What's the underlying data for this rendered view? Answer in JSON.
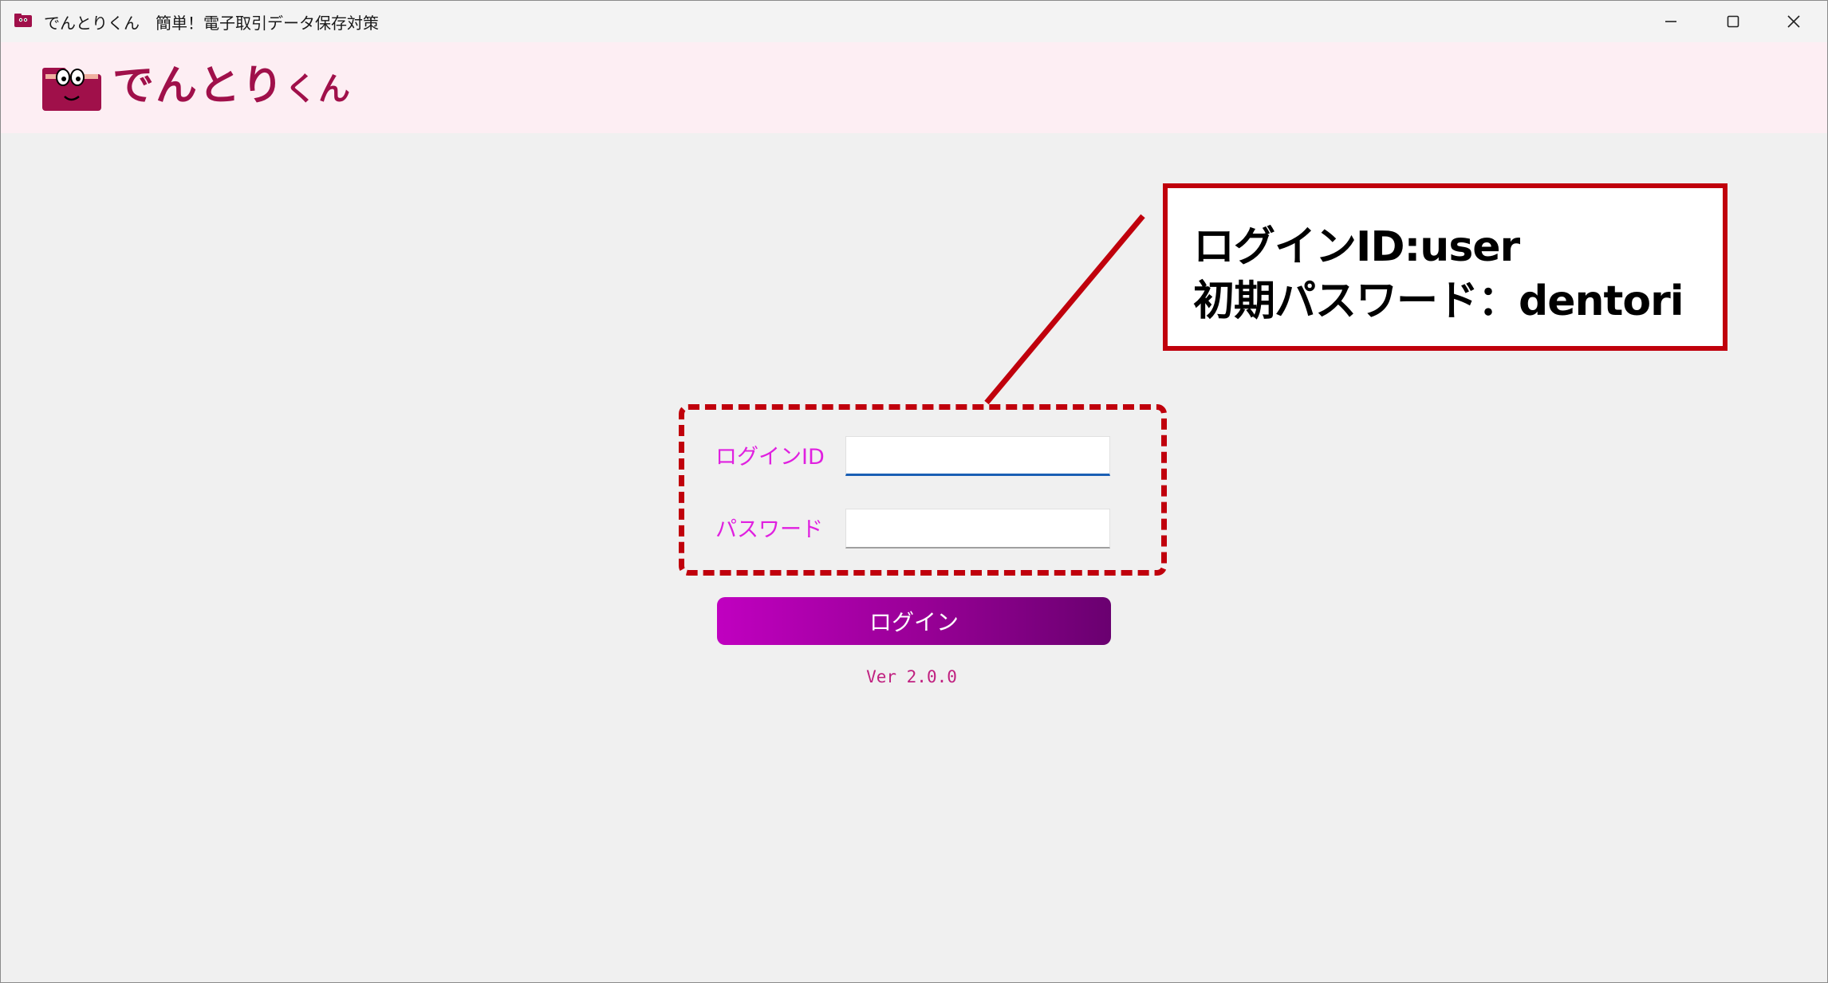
{
  "window": {
    "title": "でんとりくん　簡単！電子取引データ保存対策",
    "app_icon": "folder-mascot-icon"
  },
  "controls": {
    "minimize_icon": "minimize-icon",
    "maximize_icon": "maximize-icon",
    "close_icon": "close-icon"
  },
  "header": {
    "logo_text_main": "でんとり",
    "logo_text_small": "くん",
    "logo_icon": "folder-mascot-icon",
    "background": "#fdeef3"
  },
  "callout": {
    "line1": "ログインID:user",
    "line2": "初期パスワード：dentori",
    "border_color": "#c0000c"
  },
  "login": {
    "id_label": "ログインID",
    "id_value": "",
    "password_label": "パスワード",
    "password_value": "",
    "button_label": "ログイン",
    "label_color": "#e020e0"
  },
  "footer": {
    "version": "Ver 2.0.0"
  }
}
